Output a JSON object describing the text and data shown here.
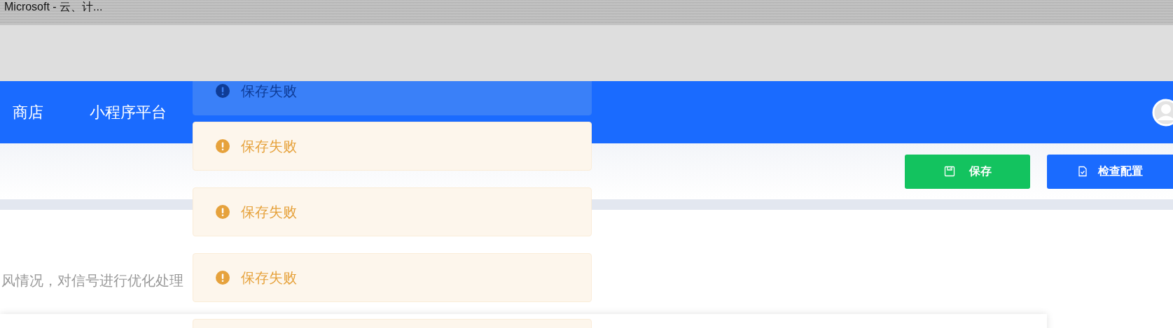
{
  "window": {
    "title": "Microsoft - 云、计..."
  },
  "nav": {
    "items": [
      {
        "label": "商店"
      },
      {
        "label": "小程序平台"
      }
    ]
  },
  "toolbar": {
    "buttons": [
      {
        "label": "保存",
        "kind": "save"
      },
      {
        "label": "检查配置",
        "kind": "check"
      }
    ]
  },
  "content": {
    "text": "风情况，对信号进行优化处理"
  },
  "toasts": [
    {
      "message": "保存失败",
      "fading": true
    },
    {
      "message": "保存失败",
      "fading": false
    },
    {
      "message": "保存失败",
      "fading": false
    },
    {
      "message": "保存失败",
      "fading": false
    },
    {
      "fading": false
    }
  ]
}
